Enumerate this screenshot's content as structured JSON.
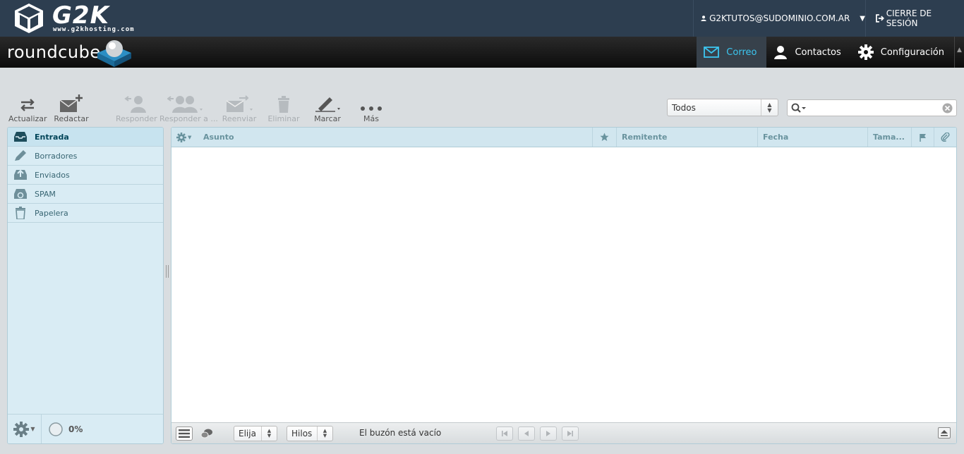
{
  "topbar": {
    "brand": "G2K",
    "brand_sub": "www.g2khosting.com",
    "user": "G2KTUTOS@SUDOMINIO.COM.AR",
    "logout": "CIERRE DE SESIÓN"
  },
  "header": {
    "logo": "roundcube",
    "tasks": [
      {
        "label": "Correo",
        "icon": "mail-icon",
        "active": true
      },
      {
        "label": "Contactos",
        "icon": "person-icon",
        "active": false
      },
      {
        "label": "Configuración",
        "icon": "gear-icon",
        "active": false
      }
    ]
  },
  "toolbar": {
    "refresh": "Actualizar",
    "compose": "Redactar",
    "reply": "Responder",
    "reply_all": "Responder a ...",
    "forward": "Reenviar",
    "delete": "Eliminar",
    "mark": "Marcar",
    "more": "Más"
  },
  "filter": {
    "selected": "Todos"
  },
  "search": {
    "value": "",
    "placeholder": ""
  },
  "folders": [
    {
      "label": "Entrada",
      "icon": "inbox-icon",
      "selected": true
    },
    {
      "label": "Borradores",
      "icon": "pencil-icon",
      "selected": false
    },
    {
      "label": "Enviados",
      "icon": "sent-icon",
      "selected": false
    },
    {
      "label": "SPAM",
      "icon": "recycle-icon",
      "selected": false
    },
    {
      "label": "Papelera",
      "icon": "trash-icon",
      "selected": false
    }
  ],
  "quota": {
    "label": "0%",
    "value": 0
  },
  "messagelist": {
    "columns": {
      "subject": "Asunto",
      "from": "Remitente",
      "date": "Fecha",
      "size": "Tama..."
    },
    "select_label": "Elija",
    "threads_label": "Hilos",
    "status": "El buzón está vacío"
  },
  "colors": {
    "topbar": "#2d3e50",
    "accent": "#3cc6f0",
    "panel": "#d9ecf4"
  }
}
